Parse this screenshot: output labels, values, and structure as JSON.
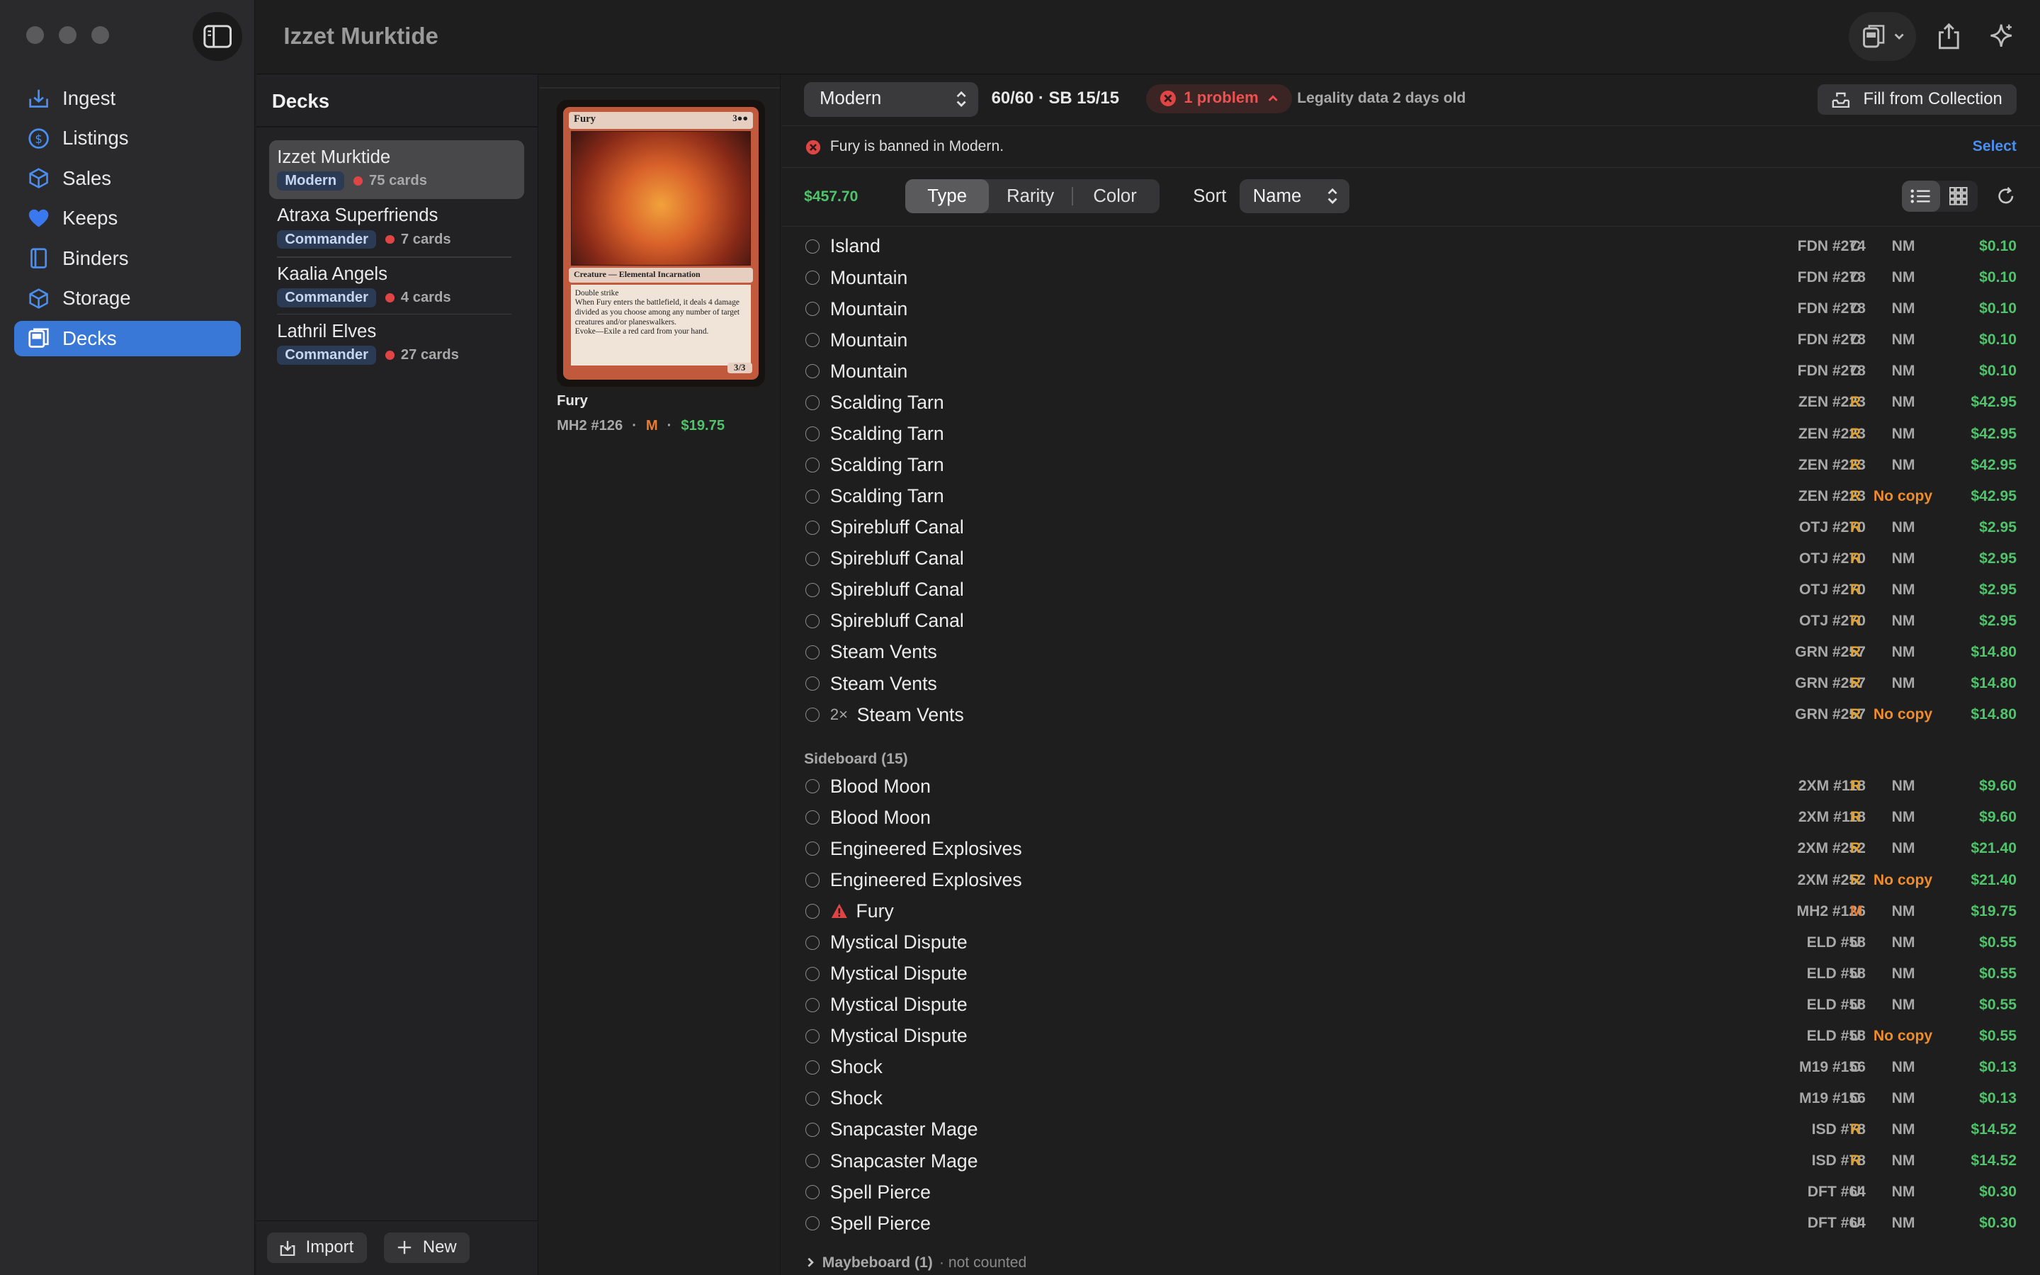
{
  "window": {
    "title": "Izzet Murktide"
  },
  "nav": {
    "items": [
      {
        "label": "Ingest",
        "icon": "ingest-icon"
      },
      {
        "label": "Listings",
        "icon": "dollar-circle-icon"
      },
      {
        "label": "Sales",
        "icon": "box-icon"
      },
      {
        "label": "Keeps",
        "icon": "heart-icon"
      },
      {
        "label": "Binders",
        "icon": "binder-icon"
      },
      {
        "label": "Storage",
        "icon": "storage-box-icon"
      },
      {
        "label": "Decks",
        "icon": "decks-icon",
        "active": true
      }
    ]
  },
  "decks": {
    "title": "Decks",
    "items": [
      {
        "name": "Izzet Murktide",
        "format": "Modern",
        "count": "75 cards",
        "selected": true
      },
      {
        "name": "Atraxa Superfriends",
        "format": "Commander",
        "count": "7 cards"
      },
      {
        "name": "Kaalia Angels",
        "format": "Commander",
        "count": "4 cards"
      },
      {
        "name": "Lathril Elves",
        "format": "Commander",
        "count": "27 cards"
      }
    ],
    "import_label": "Import",
    "new_label": "New"
  },
  "preview": {
    "card_name": "Fury",
    "card_cost": "3●●",
    "card_type": "Creature — Elemental Incarnation",
    "card_text": [
      "Double strike",
      "When Fury enters the battlefield, it deals 4 damage divided as you choose among any number of target creatures and/or planeswalkers.",
      "Evoke—Exile a red card from your hand."
    ],
    "card_pt": "3/3",
    "name": "Fury",
    "set": "MH2 #126",
    "rarity": "M",
    "price": "$19.75"
  },
  "toolbar": {
    "format": "Modern",
    "count": "60/60 · SB 15/15",
    "problem": "1 problem",
    "legality": "Legality data 2 days old",
    "fill_label": "Fill from Collection"
  },
  "banner": {
    "text": "Fury is banned in Modern.",
    "select": "Select"
  },
  "filters": {
    "total": "$457.70",
    "group_tabs": [
      "Type",
      "Rarity",
      "Color"
    ],
    "sort_label": "Sort",
    "sort_value": "Name"
  },
  "mainboard": [
    {
      "name": "Island",
      "set": "FDN #274",
      "rarity": "C",
      "cond": "NM",
      "price": "$0.10"
    },
    {
      "name": "Mountain",
      "set": "FDN #278",
      "rarity": "C",
      "cond": "NM",
      "price": "$0.10"
    },
    {
      "name": "Mountain",
      "set": "FDN #278",
      "rarity": "C",
      "cond": "NM",
      "price": "$0.10"
    },
    {
      "name": "Mountain",
      "set": "FDN #278",
      "rarity": "C",
      "cond": "NM",
      "price": "$0.10"
    },
    {
      "name": "Mountain",
      "set": "FDN #278",
      "rarity": "C",
      "cond": "NM",
      "price": "$0.10"
    },
    {
      "name": "Scalding Tarn",
      "set": "ZEN #223",
      "rarity": "R",
      "cond": "NM",
      "price": "$42.95"
    },
    {
      "name": "Scalding Tarn",
      "set": "ZEN #223",
      "rarity": "R",
      "cond": "NM",
      "price": "$42.95"
    },
    {
      "name": "Scalding Tarn",
      "set": "ZEN #223",
      "rarity": "R",
      "cond": "NM",
      "price": "$42.95"
    },
    {
      "name": "Scalding Tarn",
      "set": "ZEN #223",
      "rarity": "R",
      "cond": "No copy",
      "price": "$42.95"
    },
    {
      "name": "Spirebluff Canal",
      "set": "OTJ #270",
      "rarity": "R",
      "cond": "NM",
      "price": "$2.95"
    },
    {
      "name": "Spirebluff Canal",
      "set": "OTJ #270",
      "rarity": "R",
      "cond": "NM",
      "price": "$2.95"
    },
    {
      "name": "Spirebluff Canal",
      "set": "OTJ #270",
      "rarity": "R",
      "cond": "NM",
      "price": "$2.95"
    },
    {
      "name": "Spirebluff Canal",
      "set": "OTJ #270",
      "rarity": "R",
      "cond": "NM",
      "price": "$2.95"
    },
    {
      "name": "Steam Vents",
      "set": "GRN #257",
      "rarity": "R",
      "cond": "NM",
      "price": "$14.80"
    },
    {
      "name": "Steam Vents",
      "set": "GRN #257",
      "rarity": "R",
      "cond": "NM",
      "price": "$14.80"
    },
    {
      "name": "Steam Vents",
      "qty": "2×",
      "set": "GRN #257",
      "rarity": "R",
      "cond": "No copy",
      "price": "$14.80"
    }
  ],
  "sideboard": {
    "title": "Sideboard (15)",
    "rows": [
      {
        "name": "Blood Moon",
        "set": "2XM #118",
        "rarity": "R",
        "cond": "NM",
        "price": "$9.60"
      },
      {
        "name": "Blood Moon",
        "set": "2XM #118",
        "rarity": "R",
        "cond": "NM",
        "price": "$9.60"
      },
      {
        "name": "Engineered Explosives",
        "set": "2XM #252",
        "rarity": "R",
        "cond": "NM",
        "price": "$21.40"
      },
      {
        "name": "Engineered Explosives",
        "set": "2XM #252",
        "rarity": "R",
        "cond": "No copy",
        "price": "$21.40"
      },
      {
        "name": "Fury",
        "warn": true,
        "set": "MH2 #126",
        "rarity": "M",
        "cond": "NM",
        "price": "$19.75"
      },
      {
        "name": "Mystical Dispute",
        "set": "ELD #58",
        "rarity": "U",
        "cond": "NM",
        "price": "$0.55"
      },
      {
        "name": "Mystical Dispute",
        "set": "ELD #58",
        "rarity": "U",
        "cond": "NM",
        "price": "$0.55"
      },
      {
        "name": "Mystical Dispute",
        "set": "ELD #58",
        "rarity": "U",
        "cond": "NM",
        "price": "$0.55"
      },
      {
        "name": "Mystical Dispute",
        "set": "ELD #58",
        "rarity": "U",
        "cond": "No copy",
        "price": "$0.55"
      },
      {
        "name": "Shock",
        "set": "M19 #156",
        "rarity": "C",
        "cond": "NM",
        "price": "$0.13"
      },
      {
        "name": "Shock",
        "set": "M19 #156",
        "rarity": "C",
        "cond": "NM",
        "price": "$0.13"
      },
      {
        "name": "Snapcaster Mage",
        "set": "ISD #78",
        "rarity": "R",
        "cond": "NM",
        "price": "$14.52"
      },
      {
        "name": "Snapcaster Mage",
        "set": "ISD #78",
        "rarity": "R",
        "cond": "NM",
        "price": "$14.52"
      },
      {
        "name": "Spell Pierce",
        "set": "DFT #64",
        "rarity": "U",
        "cond": "NM",
        "price": "$0.30"
      },
      {
        "name": "Spell Pierce",
        "set": "DFT #64",
        "rarity": "U",
        "cond": "NM",
        "price": "$0.30"
      }
    ]
  },
  "maybeboard": {
    "title": "Maybeboard (1)",
    "note": "· not counted"
  },
  "colors": {
    "accent": "#3a78d8",
    "price": "#4fc46a",
    "problem": "#f05050",
    "rare": "#e0a030",
    "mythic": "#f07a2a",
    "no_copy": "#f08c2a"
  }
}
